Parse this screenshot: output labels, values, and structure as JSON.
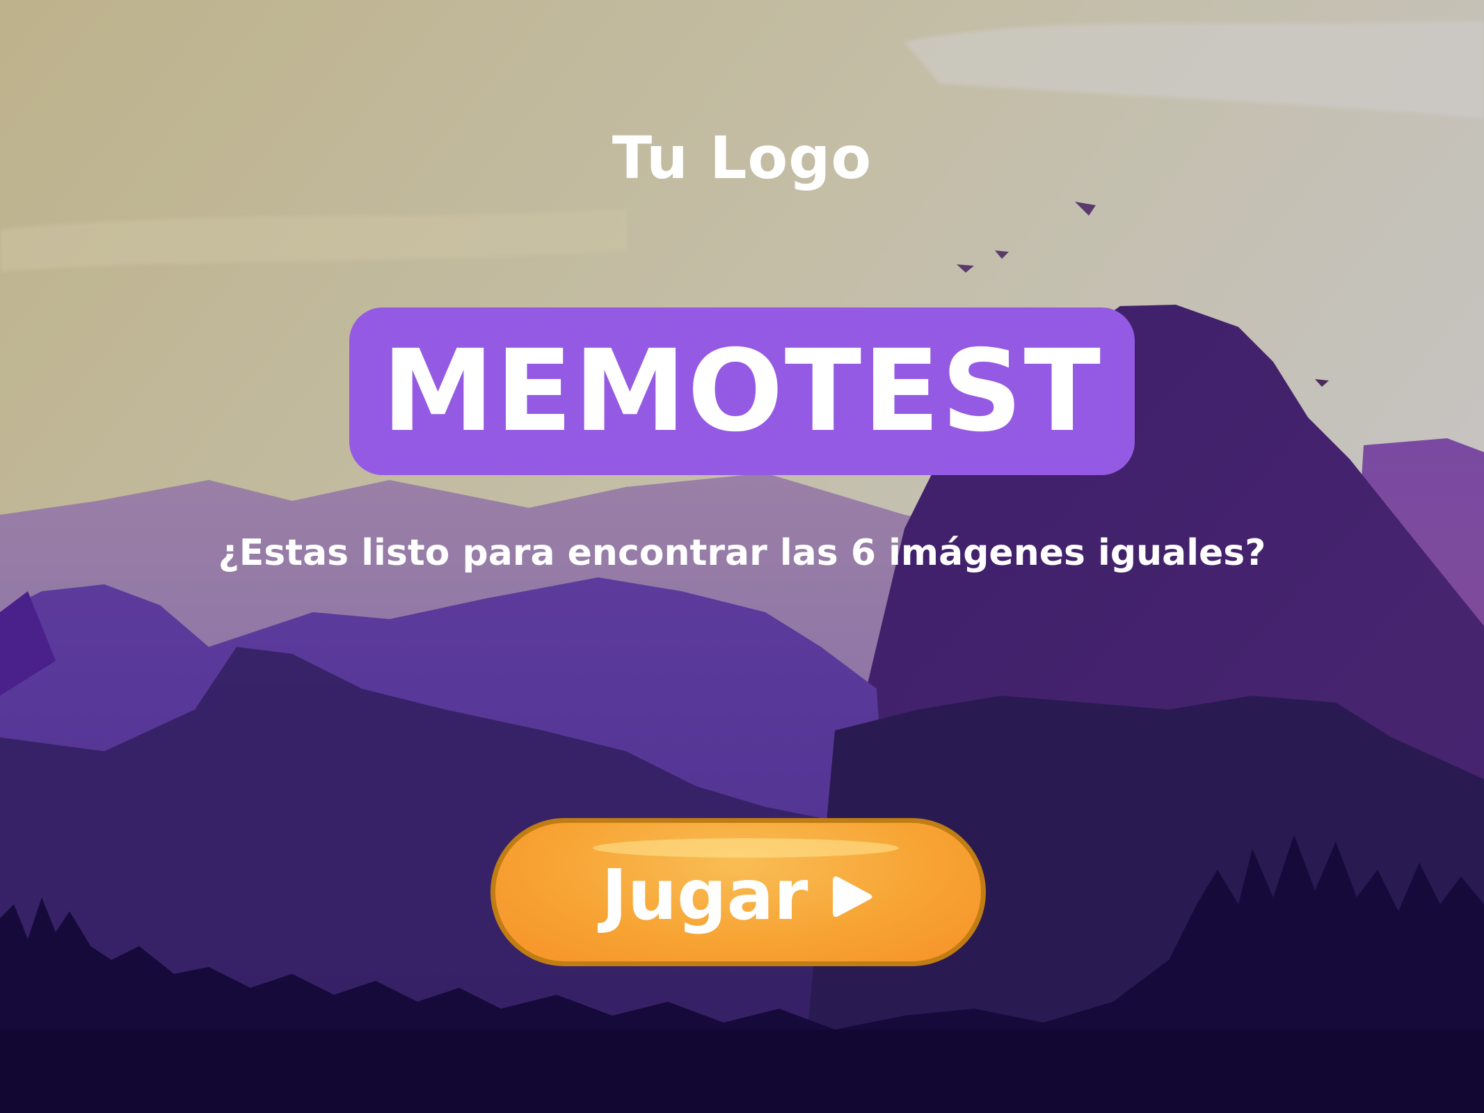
{
  "header": {
    "logo_text": "Tu Logo"
  },
  "title": {
    "text": "MEMOTEST",
    "badge_color": "#955ae3"
  },
  "subtitle": {
    "text": "¿Estas listo para encontrar las 6 imágenes iguales?"
  },
  "play_button": {
    "label": "Jugar",
    "icon": "play-icon",
    "color": "#f7a434",
    "border_color": "#c07d14"
  },
  "background": {
    "theme": "purple-mountains-landscape",
    "sky_color": "#c3b993",
    "mountain_color": "#4a2b82"
  }
}
